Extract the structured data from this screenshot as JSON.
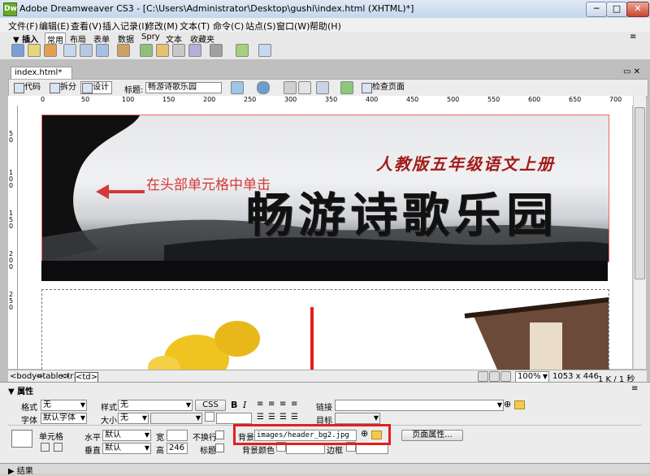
{
  "window": {
    "app_icon": "Dw",
    "title": "Adobe Dreamweaver CS3 - [C:\\Users\\Administrator\\Desktop\\gushi\\index.html (XHTML)*]",
    "minimize": "─",
    "maximize": "□",
    "close": "✕"
  },
  "menu": [
    "文件(F)",
    "编辑(E)",
    "查看(V)",
    "插入记录(I)",
    "修改(M)",
    "文本(T)",
    "命令(C)",
    "站点(S)",
    "窗口(W)",
    "帮助(H)"
  ],
  "insert_panel": {
    "tabs": [
      "▼ 插入",
      "常用",
      "布局",
      "表单",
      "数据",
      "Spry",
      "文本",
      "收藏夹"
    ],
    "active_tab": "常用"
  },
  "document": {
    "tab_label": "index.html*",
    "toolbar": {
      "code": "代码",
      "split": "拆分",
      "design": "设计",
      "title_label": "标题:",
      "title_value": "畅游诗歌乐园",
      "check_page": "检查页面"
    },
    "ruler_marks": [
      "0",
      "50",
      "100",
      "150",
      "200",
      "250",
      "300",
      "350",
      "400",
      "450",
      "500",
      "550",
      "600",
      "650",
      "700",
      "750"
    ],
    "ruler_marks_v": [
      "5",
      "0",
      "1",
      "0",
      "0",
      "1",
      "5",
      "0",
      "2",
      "0",
      "0",
      "2",
      "5",
      "0"
    ],
    "banner": {
      "subtitle": "人教版五年级语文上册",
      "main_title": "畅游诗歌乐园"
    },
    "annotation": "在头部单元格中单击"
  },
  "status": {
    "tag_path": [
      "<body>",
      "<table>",
      "<tr>",
      "<td>"
    ],
    "zoom": "100%",
    "size": "1053 x 446",
    "weight": "1 K / 1 秒"
  },
  "properties": {
    "header": "▼ 属性",
    "format_label": "格式",
    "format_value": "无",
    "style_label": "样式",
    "style_value": "无",
    "css_button": "CSS",
    "bold": "B",
    "italic": "I",
    "font_label": "字体",
    "font_value": "默认字体",
    "size_label": "大小",
    "size_value": "无",
    "link_label": "链接",
    "target_label": "目标",
    "cell_label": "单元格",
    "horizontal_label": "水平",
    "horizontal_value": "默认",
    "vertical_label": "垂直",
    "vertical_value": "默认",
    "width_label": "宽",
    "height_label": "高",
    "height_value": "246",
    "nowrap_label": "不换行",
    "header_label": "标题",
    "bg_label": "背景",
    "bg_value": "images/header_bg2.jpg",
    "bgcolor_label": "背景颜色",
    "border_label": "边框",
    "page_props_button": "页面属性...",
    "highlight_color": "#e02020"
  },
  "results_panel": "▶ 结果",
  "colors": {
    "annotation": "#d33838",
    "subtitle": "#a31b1b"
  }
}
